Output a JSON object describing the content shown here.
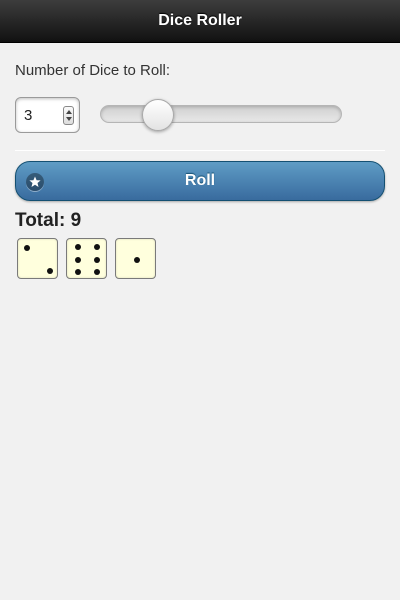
{
  "header": {
    "title": "Dice Roller"
  },
  "form": {
    "dice_count_label": "Number of Dice to Roll:",
    "dice_count_value": "3",
    "slider_level": 0.2
  },
  "roll_button": {
    "label": "Roll",
    "icon": "star-icon"
  },
  "result": {
    "total_text": "Total: 9",
    "dice_values": [
      2,
      6,
      1
    ]
  },
  "colors": {
    "header_bg": "#1e1e1e",
    "button_bg": "#4a82b4",
    "die_face": "#ffffdd"
  }
}
